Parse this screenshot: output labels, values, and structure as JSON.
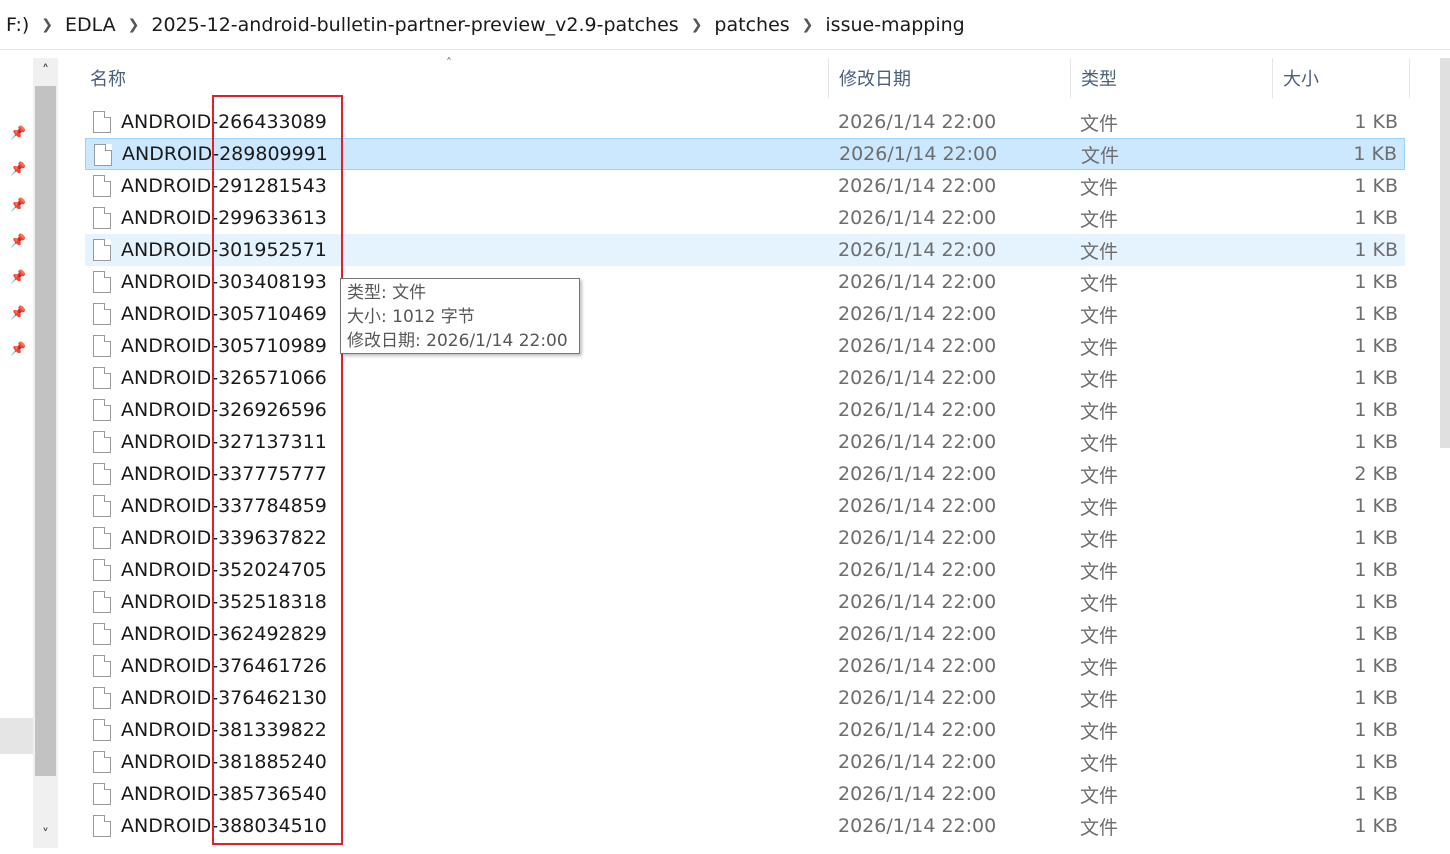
{
  "breadcrumb": [
    {
      "label": "F:)"
    },
    {
      "label": "EDLA"
    },
    {
      "label": "2025-12-android-bulletin-partner-preview_v2.9-patches"
    },
    {
      "label": "patches"
    },
    {
      "label": "issue-mapping"
    }
  ],
  "columns": {
    "name": "名称",
    "date": "修改日期",
    "type": "类型",
    "size": "大小"
  },
  "files": [
    {
      "name": "ANDROID-266433089",
      "date": "2026/1/14 22:00",
      "type": "文件",
      "size": "1 KB"
    },
    {
      "name": "ANDROID-289809991",
      "date": "2026/1/14 22:00",
      "type": "文件",
      "size": "1 KB"
    },
    {
      "name": "ANDROID-291281543",
      "date": "2026/1/14 22:00",
      "type": "文件",
      "size": "1 KB"
    },
    {
      "name": "ANDROID-299633613",
      "date": "2026/1/14 22:00",
      "type": "文件",
      "size": "1 KB"
    },
    {
      "name": "ANDROID-301952571",
      "date": "2026/1/14 22:00",
      "type": "文件",
      "size": "1 KB"
    },
    {
      "name": "ANDROID-303408193",
      "date": "2026/1/14 22:00",
      "type": "文件",
      "size": "1 KB"
    },
    {
      "name": "ANDROID-305710469",
      "date": "2026/1/14 22:00",
      "type": "文件",
      "size": "1 KB"
    },
    {
      "name": "ANDROID-305710989",
      "date": "2026/1/14 22:00",
      "type": "文件",
      "size": "1 KB"
    },
    {
      "name": "ANDROID-326571066",
      "date": "2026/1/14 22:00",
      "type": "文件",
      "size": "1 KB"
    },
    {
      "name": "ANDROID-326926596",
      "date": "2026/1/14 22:00",
      "type": "文件",
      "size": "1 KB"
    },
    {
      "name": "ANDROID-327137311",
      "date": "2026/1/14 22:00",
      "type": "文件",
      "size": "1 KB"
    },
    {
      "name": "ANDROID-337775777",
      "date": "2026/1/14 22:00",
      "type": "文件",
      "size": "2 KB"
    },
    {
      "name": "ANDROID-337784859",
      "date": "2026/1/14 22:00",
      "type": "文件",
      "size": "1 KB"
    },
    {
      "name": "ANDROID-339637822",
      "date": "2026/1/14 22:00",
      "type": "文件",
      "size": "1 KB"
    },
    {
      "name": "ANDROID-352024705",
      "date": "2026/1/14 22:00",
      "type": "文件",
      "size": "1 KB"
    },
    {
      "name": "ANDROID-352518318",
      "date": "2026/1/14 22:00",
      "type": "文件",
      "size": "1 KB"
    },
    {
      "name": "ANDROID-362492829",
      "date": "2026/1/14 22:00",
      "type": "文件",
      "size": "1 KB"
    },
    {
      "name": "ANDROID-376461726",
      "date": "2026/1/14 22:00",
      "type": "文件",
      "size": "1 KB"
    },
    {
      "name": "ANDROID-376462130",
      "date": "2026/1/14 22:00",
      "type": "文件",
      "size": "1 KB"
    },
    {
      "name": "ANDROID-381339822",
      "date": "2026/1/14 22:00",
      "type": "文件",
      "size": "1 KB"
    },
    {
      "name": "ANDROID-381885240",
      "date": "2026/1/14 22:00",
      "type": "文件",
      "size": "1 KB"
    },
    {
      "name": "ANDROID-385736540",
      "date": "2026/1/14 22:00",
      "type": "文件",
      "size": "1 KB"
    },
    {
      "name": "ANDROID-388034510",
      "date": "2026/1/14 22:00",
      "type": "文件",
      "size": "1 KB"
    }
  ],
  "selected_row": 1,
  "hover_row": 4,
  "tooltip": {
    "type_line": "类型: 文件",
    "size_line": "大小: 1012 字节",
    "date_line": "修改日期: 2026/1/14 22:00"
  },
  "icons": {
    "file": "file-icon",
    "pin": "pin-icon",
    "crumb_separator": "chevron-right-icon",
    "scroll_up": "chevron-up-icon",
    "scroll_down": "chevron-down-icon",
    "sort": "sort-up-icon"
  },
  "colors": {
    "selected_bg": "#cce8ff",
    "hover_bg": "#e5f3ff",
    "annotation_box": "#e0202a",
    "header_text": "#4c607a"
  }
}
